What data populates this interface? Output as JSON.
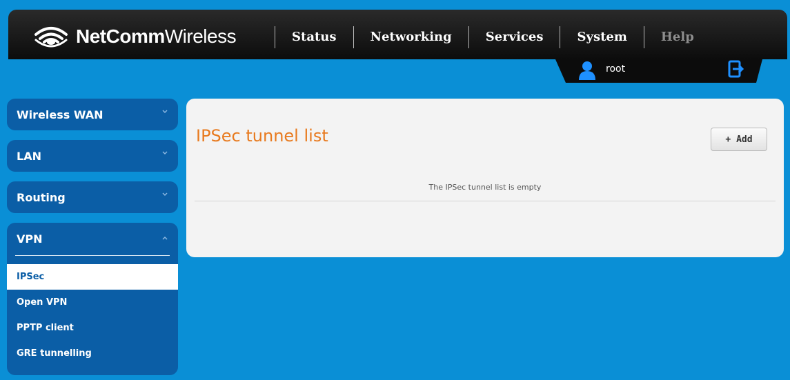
{
  "header": {
    "brand_bold": "NetComm",
    "brand_light": "Wireless",
    "nav": [
      "Status",
      "Networking",
      "Services",
      "System",
      "Help"
    ],
    "user": "root"
  },
  "sidebar": {
    "sections": [
      "Wireless WAN",
      "LAN",
      "Routing"
    ],
    "vpn": {
      "label": "VPN",
      "items": [
        "IPSec",
        "Open VPN",
        "PPTP client",
        "GRE tunnelling"
      ],
      "active": "IPSec"
    }
  },
  "main": {
    "title": "IPSec tunnel list",
    "add_label": "+ Add",
    "empty_message": "The IPSec tunnel list is empty"
  },
  "colors": {
    "background": "#0a8fd6",
    "sidebar": "#0b5ea6",
    "title": "#e87a1e",
    "header": "#0c0c0c"
  },
  "icons": [
    "wifi-logo-icon",
    "user-icon",
    "logout-icon",
    "chevron-down-icon",
    "chevron-up-icon"
  ]
}
